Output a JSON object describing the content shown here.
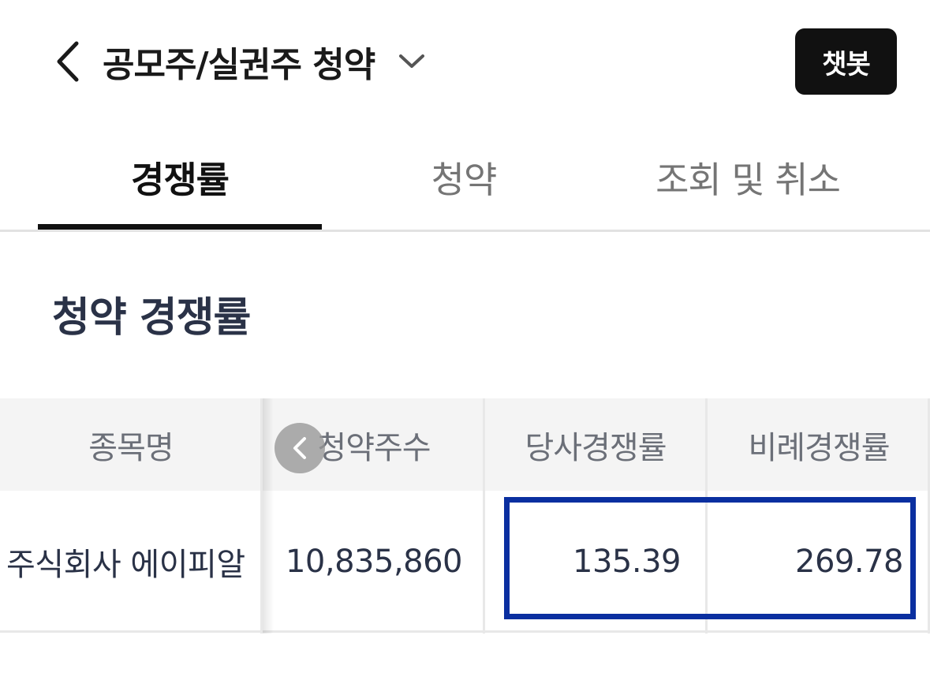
{
  "header": {
    "title": "공모주/실권주 청약",
    "chatbot_label": "챗봇"
  },
  "tabs": [
    {
      "label": "경쟁률",
      "active": true
    },
    {
      "label": "청약",
      "active": false
    },
    {
      "label": "조회 및 취소",
      "active": false
    }
  ],
  "section": {
    "title": "청약 경쟁률"
  },
  "table": {
    "columns": [
      "종목명",
      "청약주수",
      "당사경쟁률",
      "비례경쟁률"
    ],
    "rows": [
      {
        "name": "주식회사 에이피알",
        "shares": "10,835,860",
        "company_rate": "135.39",
        "proportional_rate": "269.78"
      }
    ]
  },
  "colors": {
    "highlight_border": "#0a2fa0",
    "chatbot_bg": "#111111",
    "section_title": "#2a3247"
  },
  "icons": {
    "back": "chevron-left-icon",
    "title_dropdown": "chevron-down-icon",
    "table_scroll": "chevron-left-icon"
  }
}
